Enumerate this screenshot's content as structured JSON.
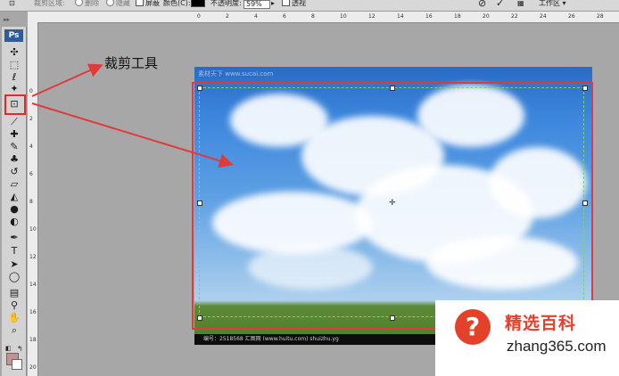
{
  "options_bar": {
    "tool_glyph": "⊡",
    "crop_area_label": "裁剪区域:",
    "delete_option": "删除",
    "hide_option": "隐藏",
    "shield_label": "屏蔽",
    "color_label": "颜色(C):",
    "opacity_label": "不透明度:",
    "opacity_value": "59%",
    "perspective_label": "透视",
    "cancel_glyph": "⊘",
    "commit_glyph": "✓",
    "workspace_label": "工作区",
    "shield_color": "#000000"
  },
  "toolbox": {
    "logo": "Ps",
    "grip": "▸▸",
    "tools": [
      {
        "name": "move-tool-icon",
        "glyph": "✣"
      },
      {
        "name": "marquee-tool-icon",
        "glyph": "⬚"
      },
      {
        "name": "lasso-tool-icon",
        "glyph": "ℓ"
      },
      {
        "name": "magic-wand-tool-icon",
        "glyph": "✦"
      },
      {
        "name": "crop-tool-icon",
        "glyph": "⊡"
      },
      {
        "name": "slice-tool-icon",
        "glyph": "⟋"
      },
      {
        "name": "healing-brush-tool-icon",
        "glyph": "✚"
      },
      {
        "name": "brush-tool-icon",
        "glyph": "✎"
      },
      {
        "name": "clone-stamp-tool-icon",
        "glyph": "♣"
      },
      {
        "name": "history-brush-tool-icon",
        "glyph": "↺"
      },
      {
        "name": "eraser-tool-icon",
        "glyph": "▱"
      },
      {
        "name": "paint-bucket-tool-icon",
        "glyph": "◭"
      },
      {
        "name": "blur-tool-icon",
        "glyph": "●"
      },
      {
        "name": "dodge-tool-icon",
        "glyph": "◐"
      },
      {
        "name": "pen-tool-icon",
        "glyph": "✒"
      },
      {
        "name": "type-tool-icon",
        "glyph": "T"
      },
      {
        "name": "path-selection-tool-icon",
        "glyph": "➤"
      },
      {
        "name": "shape-tool-icon",
        "glyph": "◯"
      },
      {
        "name": "notes-tool-icon",
        "glyph": "▤"
      },
      {
        "name": "eyedropper-tool-icon",
        "glyph": "⚲"
      },
      {
        "name": "hand-tool-icon",
        "glyph": "✋"
      },
      {
        "name": "zoom-tool-icon",
        "glyph": "⌕"
      }
    ],
    "foreground_color": "#c89191",
    "background_color": "#ffffff"
  },
  "ruler": {
    "top_labels": [
      "0",
      "2",
      "4",
      "6",
      "8",
      "10",
      "12",
      "14",
      "16",
      "18",
      "20",
      "22",
      "24",
      "26",
      "28"
    ],
    "left_labels": [
      "0",
      "2",
      "4",
      "6",
      "8",
      "10",
      "12",
      "14",
      "16",
      "18",
      "20"
    ]
  },
  "canvas": {
    "watermark_top": "素材天下 www.sucai.com",
    "strip_text": "编号：2518568    汇图网 (www.huitu.com)    shuizhu.yg"
  },
  "annotation": {
    "label": "裁剪工具",
    "color": "#e03a3a"
  },
  "brand": {
    "icon_glyph": "?",
    "name": "精选百科",
    "url": "zhang365.com",
    "color": "#e4412b"
  }
}
